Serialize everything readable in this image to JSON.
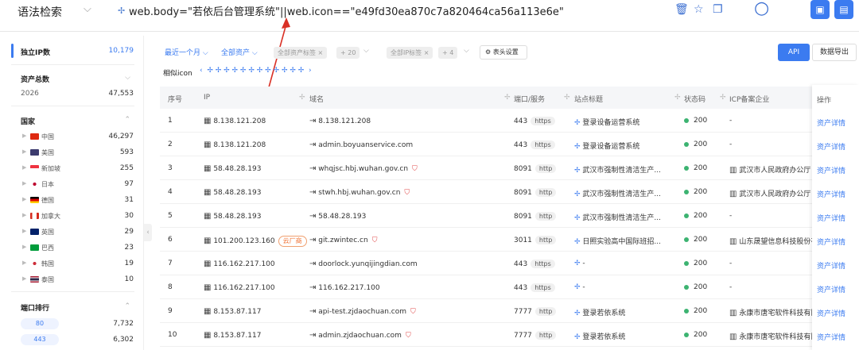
{
  "topbar": {
    "syntax_label": "语法检索",
    "query": "web.body=\"若依后台管理系统\"||web.icon==\"e49fd30ea870c7a820464ca56a113e6e\""
  },
  "sidebar": {
    "ip_count_label": "独立IP数",
    "ip_count": "10,179",
    "asset_total_label": "资产总数",
    "asset_year": "2026",
    "asset_total": "47,553",
    "country_label": "国家",
    "countries": [
      {
        "name": "中国",
        "count": "46,297",
        "color": "#de2910"
      },
      {
        "name": "美国",
        "count": "593",
        "color": "#3c3b6e"
      },
      {
        "name": "新加坡",
        "count": "255",
        "color": "#ef3340"
      },
      {
        "name": "日本",
        "count": "97",
        "color": "#bc002d"
      },
      {
        "name": "德国",
        "count": "31",
        "color": "#000000"
      },
      {
        "name": "加拿大",
        "count": "30",
        "color": "#d52b1e"
      },
      {
        "name": "英国",
        "count": "29",
        "color": "#012169"
      },
      {
        "name": "巴西",
        "count": "23",
        "color": "#009c3b"
      },
      {
        "name": "韩国",
        "count": "19",
        "color": "#cd2e3a"
      },
      {
        "name": "泰国",
        "count": "10",
        "color": "#2d2a4a"
      }
    ],
    "port_rank_label": "端口排行",
    "ports": [
      {
        "port": "80",
        "count": "7,732"
      },
      {
        "port": "443",
        "count": "6,302"
      }
    ]
  },
  "filters": {
    "recent_month": "最近一个月",
    "all_assets": "全部资产",
    "all_asset_tags": "全部资产标签",
    "asset_tags_more": "+ 20",
    "all_ip_tags": "全部IP标签",
    "ip_tags_more": "+ 4",
    "table_settings": "表头设置",
    "api": "API",
    "export": "数据导出",
    "similar_icon": "相似icon"
  },
  "table": {
    "headers": {
      "no": "序号",
      "ip": "IP",
      "domain": "域名",
      "port": "端口/服务",
      "title": "站点标题",
      "status": "状态码",
      "icp": "ICP备案企业",
      "op": "操作"
    },
    "op_link": "资产详情",
    "rows": [
      {
        "no": "1",
        "ip": "8.138.121.208",
        "domain": "8.138.121.208",
        "port": "443",
        "svc": "https",
        "title": "登录设备运营系统",
        "status": "200",
        "icp": "-"
      },
      {
        "no": "2",
        "ip": "8.138.121.208",
        "domain": "admin.boyuanservice.com",
        "port": "443",
        "svc": "https",
        "title": "登录设备运营系统",
        "status": "200",
        "icp": "-"
      },
      {
        "no": "3",
        "ip": "58.48.28.193",
        "domain": "whqjsc.hbj.wuhan.gov.cn",
        "port": "8091",
        "svc": "http",
        "title": "武汉市强制性清洁生产...",
        "status": "200",
        "icp": "武汉市人民政府办公厅"
      },
      {
        "no": "4",
        "ip": "58.48.28.193",
        "domain": "stwh.hbj.wuhan.gov.cn",
        "port": "8091",
        "svc": "http",
        "title": "武汉市强制性清洁生产...",
        "status": "200",
        "icp": "武汉市人民政府办公厅"
      },
      {
        "no": "5",
        "ip": "58.48.28.193",
        "domain": "58.48.28.193",
        "port": "8091",
        "svc": "http",
        "title": "武汉市强制性清洁生产...",
        "status": "200",
        "icp": "-"
      },
      {
        "no": "6",
        "ip": "101.200.123.160",
        "cloud": "云厂商",
        "domain": "git.zwintec.cn",
        "port": "3011",
        "svc": "http",
        "title": "日照实验高中国际班招...",
        "status": "200",
        "icp": "山东晟望信息科技股份有"
      },
      {
        "no": "7",
        "ip": "116.162.217.100",
        "domain": "doorlock.yunqijingdian.com",
        "port": "443",
        "svc": "https",
        "title": "-",
        "status": "200",
        "icp": "-"
      },
      {
        "no": "8",
        "ip": "116.162.217.100",
        "domain": "116.162.217.100",
        "port": "443",
        "svc": "https",
        "title": "-",
        "status": "200",
        "icp": "-"
      },
      {
        "no": "9",
        "ip": "8.153.87.117",
        "domain": "api-test.zjdaochuan.com",
        "port": "7777",
        "svc": "http",
        "title": "登录若依系统",
        "status": "200",
        "icp": "永康市唐宅软件科技有限"
      },
      {
        "no": "10",
        "ip": "8.153.87.117",
        "domain": "admin.zjdaochuan.com",
        "port": "7777",
        "svc": "http",
        "title": "登录若依系统",
        "status": "200",
        "icp": "永康市唐宅软件科技有限"
      }
    ]
  }
}
